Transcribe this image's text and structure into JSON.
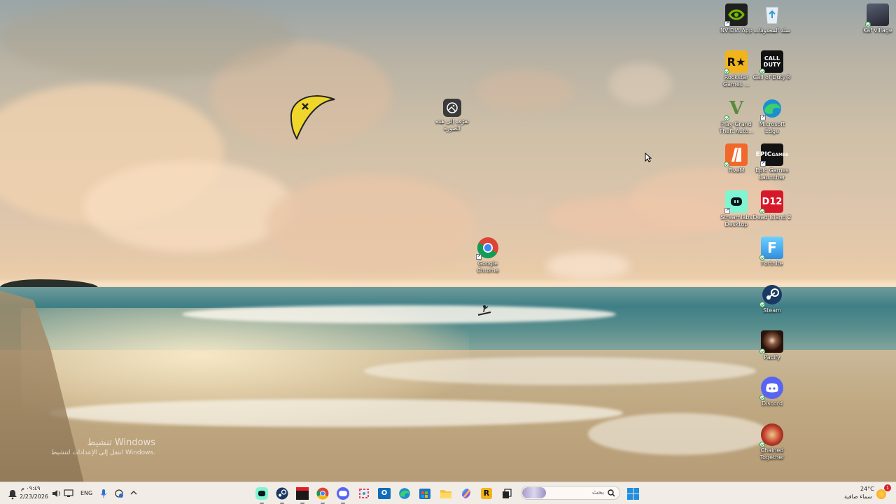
{
  "desktop": {
    "watermark": {
      "title": "تنشيط Windows",
      "subtitle": "انتقل إلى الإعدادات لتنشيط Windows."
    },
    "icons": [
      {
        "id": "nvidia",
        "label": "NVIDIA App",
        "icon": "nvidia-icon",
        "color": "#1f1f1f"
      },
      {
        "id": "recycle-bin",
        "label": "سلة المحذوفات",
        "icon": "recycle-bin-icon",
        "color": "#dfe8ef"
      },
      {
        "id": "kaf-village",
        "label": "Kaf village",
        "icon": "kaf-village-icon",
        "color": "#2b2f3a"
      },
      {
        "id": "rockstar",
        "label": "Rockstar Games ...",
        "icon": "rockstar-icon",
        "color": "#f2b41c"
      },
      {
        "id": "cod",
        "label": "Call of Duty®",
        "icon": "call-of-duty-icon",
        "color": "#111111"
      },
      {
        "id": "gta",
        "label": "Play Grand Theft Auto...",
        "icon": "gta-icon",
        "color": "#ffffff"
      },
      {
        "id": "edge",
        "label": "Microsoft Edge",
        "icon": "edge-icon",
        "color": "#1b8fd0"
      },
      {
        "id": "fivem",
        "label": "FiveM",
        "icon": "fivem-icon",
        "color": "#f2672a"
      },
      {
        "id": "epic",
        "label": "Epic Games Launcher",
        "icon": "epic-games-icon",
        "color": "#121212"
      },
      {
        "id": "streamlabs",
        "label": "Streamlabs Desktop",
        "icon": "streamlabs-icon",
        "color": "#80f5d2"
      },
      {
        "id": "dead-island",
        "label": "Dead Island 2",
        "icon": "dead-island-icon",
        "color": "#d7182a"
      },
      {
        "id": "fortnite",
        "label": "Fortnite",
        "icon": "fortnite-icon",
        "color": "#4bb7f0"
      },
      {
        "id": "steam",
        "label": "Steam",
        "icon": "steam-icon",
        "color": "#1b3a63"
      },
      {
        "id": "pacify",
        "label": "Pacify",
        "icon": "pacify-icon",
        "color": "#3a1a12"
      },
      {
        "id": "discord",
        "label": "Discord",
        "icon": "discord-icon",
        "color": "#5865f2"
      },
      {
        "id": "chained",
        "label": "Chained Together",
        "icon": "chained-together-icon",
        "color": "#c03a2a"
      },
      {
        "id": "learn-image",
        "label": "تعرّف إلى هذه الصورة",
        "icon": "learn-about-picture-icon",
        "color": "#3a3a3a"
      },
      {
        "id": "chrome",
        "label": "Google Chrome",
        "icon": "chrome-icon",
        "color": "#ffffff"
      }
    ]
  },
  "taskbar": {
    "search_placeholder": "بحث",
    "language": "ENG",
    "time": "٠٩:٤٩ م",
    "date": "2/23/2026",
    "weather_temp": "24°C",
    "weather_desc": "سماء صافية",
    "notification_count": "1",
    "apps": [
      {
        "id": "streamlabs",
        "icon": "streamlabs-icon",
        "running": true
      },
      {
        "id": "steam",
        "icon": "steam-icon",
        "running": true
      },
      {
        "id": "voicemod",
        "icon": "voicemod-icon",
        "running": true
      },
      {
        "id": "chrome",
        "icon": "chrome-icon",
        "running": true
      },
      {
        "id": "discord",
        "icon": "discord-icon",
        "running": true
      },
      {
        "id": "snipping",
        "icon": "snipping-tool-icon",
        "running": false
      },
      {
        "id": "outlook",
        "icon": "outlook-icon",
        "running": false
      },
      {
        "id": "edge",
        "icon": "edge-icon",
        "running": false
      },
      {
        "id": "store",
        "icon": "microsoft-store-icon",
        "running": false
      },
      {
        "id": "explorer",
        "icon": "file-explorer-icon",
        "running": false
      },
      {
        "id": "copilot",
        "icon": "copilot-icon",
        "running": false
      },
      {
        "id": "rockstar",
        "icon": "rockstar-icon",
        "running": false
      },
      {
        "id": "taskview",
        "icon": "task-view-icon",
        "running": false
      }
    ]
  }
}
